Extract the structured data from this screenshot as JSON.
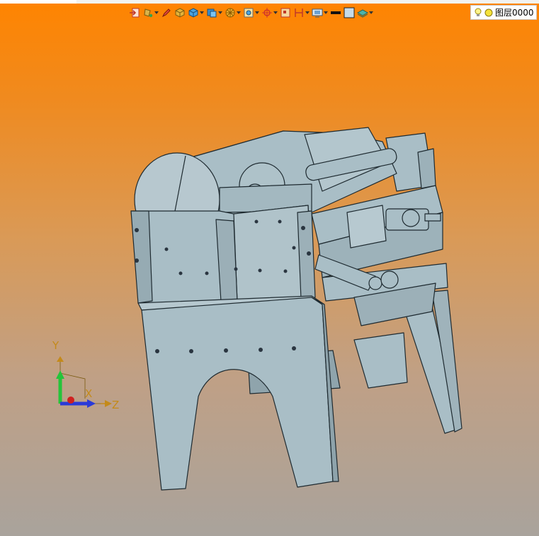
{
  "app": {
    "background_top": "#ff8400",
    "background_bottom": "#a9a39c"
  },
  "toolbar": {
    "tools": [
      {
        "icon": "import-arrow-icon"
      },
      {
        "icon": "paint-bucket-icon"
      },
      {
        "icon": "pencil-sketch-icon"
      },
      {
        "icon": "gold-cube-icon"
      },
      {
        "icon": "blue-cube-icon"
      },
      {
        "icon": "cube-layers-icon"
      },
      {
        "icon": "render-wheel-icon"
      },
      {
        "icon": "zoom-fit-icon"
      },
      {
        "icon": "crosshair-icon"
      },
      {
        "icon": "snap-grid-icon"
      },
      {
        "icon": "dimension-icon"
      },
      {
        "icon": "display-settings-icon"
      },
      {
        "icon": "line-color-icon"
      },
      {
        "icon": "fill-color-icon"
      },
      {
        "icon": "layer-stack-icon"
      }
    ],
    "layer": {
      "name": "图层0000",
      "colors": {
        "bulb": "#fff38a",
        "dot": "#f5e23a"
      }
    }
  },
  "axes": {
    "x": "X",
    "y": "Y",
    "z": "Z"
  },
  "model": {
    "color": "#a9bec6",
    "edge": "#1e2a30"
  }
}
